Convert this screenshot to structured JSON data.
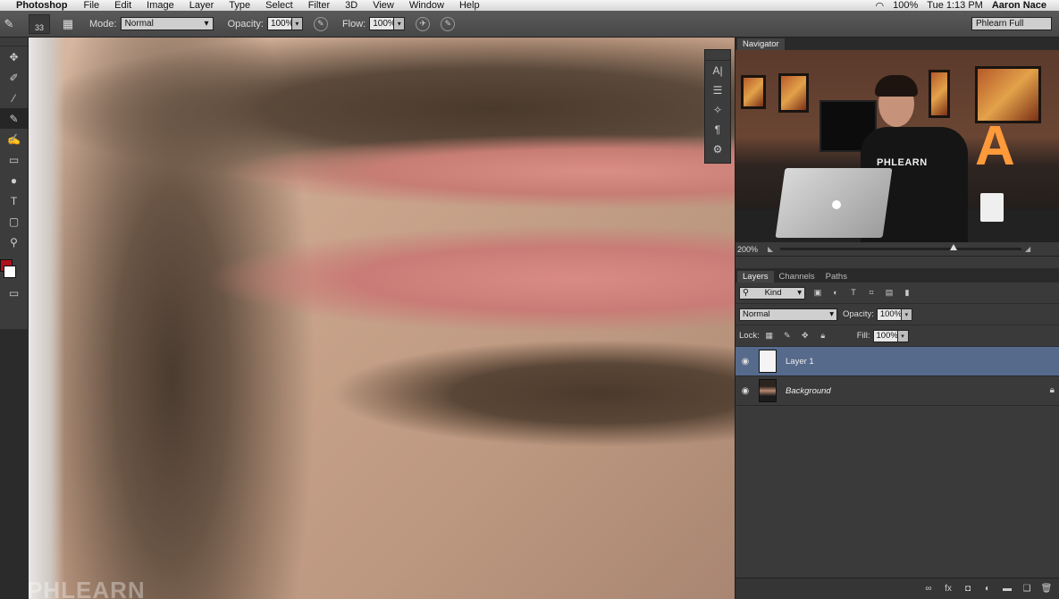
{
  "menubar": {
    "app": "Photoshop",
    "items": [
      "File",
      "Edit",
      "Image",
      "Layer",
      "Type",
      "Select",
      "Filter",
      "3D",
      "View",
      "Window",
      "Help"
    ],
    "status": {
      "battery": "100%",
      "clock": "Tue 1:13 PM",
      "user": "Aaron Nace"
    }
  },
  "options": {
    "brush_size": "33",
    "mode_label": "Mode:",
    "mode_value": "Normal",
    "opacity_label": "Opacity:",
    "opacity_value": "100%",
    "flow_label": "Flow:",
    "flow_value": "100%",
    "workspace": "Phlearn Full"
  },
  "canvas": {
    "watermark": "PHLEARN"
  },
  "navigator": {
    "tab": "Navigator",
    "zoom": "200%",
    "zoom_fraction": 0.72,
    "shirt_text": "PHLEARN",
    "sign_letter": "A"
  },
  "layers_panel": {
    "tabs": [
      "Layers",
      "Channels",
      "Paths"
    ],
    "filter_kind": "Kind",
    "blend_mode": "Normal",
    "opacity_label": "Opacity:",
    "opacity_value": "100%",
    "lock_label": "Lock:",
    "fill_label": "Fill:",
    "fill_value": "100%",
    "layers": [
      {
        "name": "Layer 1"
      },
      {
        "name": "Background"
      }
    ]
  },
  "colors": {
    "foreground": "#b0111a",
    "background": "#ffffff",
    "selected_layer": "#566a8c"
  }
}
